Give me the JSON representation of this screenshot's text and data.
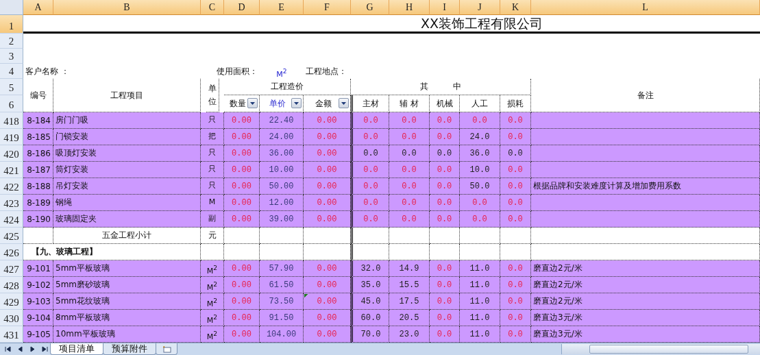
{
  "column_headers": [
    "A",
    "B",
    "C",
    "D",
    "E",
    "F",
    "G",
    "H",
    "I",
    "J",
    "K",
    "L"
  ],
  "title_row": {
    "num": "1",
    "text": "XX装饰工程有限公司",
    "selected": true
  },
  "blank_rows": [
    {
      "num": "2"
    },
    {
      "num": "3"
    }
  ],
  "info_row": {
    "num": "4",
    "customer_label": "客户名称 ：",
    "area_label": "使用面积：",
    "area_unit": "M$^{2}$",
    "site_label": "工程地点："
  },
  "header": {
    "nums": [
      "5",
      "6"
    ],
    "code": "编号",
    "item": "工程项目",
    "unit": "单位",
    "cost_group": "工程造价",
    "cost_columns": [
      "数量",
      "单价",
      "金额"
    ],
    "breakdown_group": "其　　　中",
    "breakdown_columns": [
      "主材",
      "辅 材",
      "机械",
      "人工",
      "损耗"
    ],
    "remarks": "备注"
  },
  "rows": [
    {
      "kind": "item",
      "num": "418",
      "code": "8-184",
      "name": "房门门吸",
      "unit": "只",
      "cells": [
        {
          "v": "0.00",
          "kind": "zero"
        },
        {
          "v": "22.40",
          "kind": "price"
        },
        {
          "v": "0.00",
          "kind": "zero"
        },
        {
          "v": "0.0",
          "kind": "zero"
        },
        {
          "v": "0.0",
          "kind": "zero"
        },
        {
          "v": "0.0",
          "kind": "zero"
        },
        {
          "v": "0.0",
          "kind": "zero"
        },
        {
          "v": "0.0",
          "kind": "zero"
        }
      ]
    },
    {
      "kind": "item",
      "num": "419",
      "code": "8-185",
      "name": "门锁安装",
      "unit": "把",
      "cells": [
        {
          "v": "0.00",
          "kind": "zero"
        },
        {
          "v": "24.00",
          "kind": "price"
        },
        {
          "v": "0.00",
          "kind": "zero"
        },
        {
          "v": "0.0",
          "kind": "zero"
        },
        {
          "v": "0.0",
          "kind": "zero"
        },
        {
          "v": "0.0",
          "kind": "zero"
        },
        {
          "v": "24.0",
          "kind": "value"
        },
        {
          "v": "0.0",
          "kind": "zero"
        }
      ]
    },
    {
      "kind": "item",
      "num": "420",
      "code": "8-186",
      "name": "吸顶灯安装",
      "unit": "只",
      "cells": [
        {
          "v": "0.00",
          "kind": "zero"
        },
        {
          "v": "36.00",
          "kind": "price"
        },
        {
          "v": "0.00",
          "kind": "zero"
        },
        {
          "v": "0.0",
          "kind": "value"
        },
        {
          "v": "0.0",
          "kind": "value"
        },
        {
          "v": "0.0",
          "kind": "value"
        },
        {
          "v": "36.0",
          "kind": "value"
        },
        {
          "v": "0.0",
          "kind": "value"
        }
      ]
    },
    {
      "kind": "item",
      "num": "421",
      "code": "8-187",
      "name": "筒灯安装",
      "unit": "只",
      "cells": [
        {
          "v": "0.00",
          "kind": "zero"
        },
        {
          "v": "10.00",
          "kind": "price"
        },
        {
          "v": "0.00",
          "kind": "zero"
        },
        {
          "v": "0.0",
          "kind": "zero"
        },
        {
          "v": "0.0",
          "kind": "zero"
        },
        {
          "v": "0.0",
          "kind": "zero"
        },
        {
          "v": "10.0",
          "kind": "value"
        },
        {
          "v": "0.0",
          "kind": "zero"
        }
      ]
    },
    {
      "kind": "item",
      "num": "422",
      "code": "8-188",
      "name": "吊灯安装",
      "unit": "只",
      "cells": [
        {
          "v": "0.00",
          "kind": "zero"
        },
        {
          "v": "50.00",
          "kind": "price"
        },
        {
          "v": "0.00",
          "kind": "zero"
        },
        {
          "v": "0.0",
          "kind": "zero"
        },
        {
          "v": "0.0",
          "kind": "zero"
        },
        {
          "v": "0.0",
          "kind": "zero"
        },
        {
          "v": "50.0",
          "kind": "value"
        },
        {
          "v": "0.0",
          "kind": "zero"
        }
      ],
      "remark": "根据品牌和安装难度计算及增加费用系数"
    },
    {
      "kind": "item",
      "num": "423",
      "code": "8-189",
      "name": "钢绳",
      "unit": "M",
      "cells": [
        {
          "v": "0.00",
          "kind": "zero"
        },
        {
          "v": "12.00",
          "kind": "price"
        },
        {
          "v": "0.00",
          "kind": "zero"
        },
        {
          "v": "0.0",
          "kind": "zero"
        },
        {
          "v": "0.0",
          "kind": "zero"
        },
        {
          "v": "0.0",
          "kind": "zero"
        },
        {
          "v": "0.0",
          "kind": "zero"
        },
        {
          "v": "0.0",
          "kind": "zero"
        }
      ]
    },
    {
      "kind": "item",
      "num": "424",
      "code": "8-190",
      "name": "玻璃固定夹",
      "unit": "副",
      "cells": [
        {
          "v": "0.00",
          "kind": "zero"
        },
        {
          "v": "39.00",
          "kind": "price"
        },
        {
          "v": "0.00",
          "kind": "zero"
        },
        {
          "v": "0.0",
          "kind": "zero"
        },
        {
          "v": "0.0",
          "kind": "zero"
        },
        {
          "v": "0.0",
          "kind": "zero"
        },
        {
          "v": "0.0",
          "kind": "zero"
        },
        {
          "v": "0.0",
          "kind": "zero"
        }
      ]
    },
    {
      "kind": "subtotal",
      "num": "425",
      "label": "五金工程小计",
      "unit": "元"
    },
    {
      "kind": "section",
      "num": "426",
      "label": "【九、玻璃工程】"
    },
    {
      "kind": "item",
      "num": "427",
      "code": "9-101",
      "name": "5mm平板玻璃",
      "unit": "M$^{2}$",
      "cells": [
        {
          "v": "0.00",
          "kind": "zero"
        },
        {
          "v": "57.90",
          "kind": "price"
        },
        {
          "v": "0.00",
          "kind": "zero"
        },
        {
          "v": "32.0",
          "kind": "value"
        },
        {
          "v": "14.9",
          "kind": "value"
        },
        {
          "v": "0.0",
          "kind": "zero"
        },
        {
          "v": "11.0",
          "kind": "value"
        },
        {
          "v": "0.0",
          "kind": "zero"
        }
      ],
      "remark": "磨直边2元/米"
    },
    {
      "kind": "item",
      "num": "428",
      "code": "9-102",
      "name": "5mm磨砂玻璃",
      "unit": "M$^{2}$",
      "cells": [
        {
          "v": "0.00",
          "kind": "zero"
        },
        {
          "v": "61.50",
          "kind": "price"
        },
        {
          "v": "0.00",
          "kind": "zero"
        },
        {
          "v": "35.0",
          "kind": "value"
        },
        {
          "v": "15.5",
          "kind": "value"
        },
        {
          "v": "0.0",
          "kind": "zero"
        },
        {
          "v": "11.0",
          "kind": "value"
        },
        {
          "v": "0.0",
          "kind": "zero"
        }
      ],
      "remark": "磨直边2元/米"
    },
    {
      "kind": "item",
      "num": "429",
      "code": "9-103",
      "name": "5mm花纹玻璃",
      "unit": "M$^{2}$",
      "cells": [
        {
          "v": "0.00",
          "kind": "zero"
        },
        {
          "v": "73.50",
          "kind": "price"
        },
        {
          "v": "0.00",
          "kind": "zero",
          "flag": true
        },
        {
          "v": "45.0",
          "kind": "value"
        },
        {
          "v": "17.5",
          "kind": "value"
        },
        {
          "v": "0.0",
          "kind": "zero"
        },
        {
          "v": "11.0",
          "kind": "value"
        },
        {
          "v": "0.0",
          "kind": "zero"
        }
      ],
      "remark": "磨直边2元/米"
    },
    {
      "kind": "item",
      "num": "430",
      "code": "9-104",
      "name": "8mm平板玻璃",
      "unit": "M$^{2}$",
      "cells": [
        {
          "v": "0.00",
          "kind": "zero"
        },
        {
          "v": "91.50",
          "kind": "price"
        },
        {
          "v": "0.00",
          "kind": "zero"
        },
        {
          "v": "60.0",
          "kind": "value"
        },
        {
          "v": "20.5",
          "kind": "value"
        },
        {
          "v": "0.0",
          "kind": "zero"
        },
        {
          "v": "11.0",
          "kind": "value"
        },
        {
          "v": "0.0",
          "kind": "zero"
        }
      ],
      "remark": "磨直边3元/米"
    },
    {
      "kind": "item",
      "num": "431",
      "code": "9-105",
      "name": "10mm平板玻璃",
      "unit": "M$^{2}$",
      "cells": [
        {
          "v": "0.00",
          "kind": "zero"
        },
        {
          "v": "104.00",
          "kind": "price"
        },
        {
          "v": "0.00",
          "kind": "zero"
        },
        {
          "v": "70.0",
          "kind": "value"
        },
        {
          "v": "23.0",
          "kind": "value"
        },
        {
          "v": "0.0",
          "kind": "zero"
        },
        {
          "v": "11.0",
          "kind": "value"
        },
        {
          "v": "0.0",
          "kind": "zero"
        }
      ],
      "remark": "磨直边3元/米"
    }
  ],
  "tabs": [
    {
      "label": "项目清单",
      "selected": true
    },
    {
      "label": "预算附件",
      "selected": false
    }
  ]
}
